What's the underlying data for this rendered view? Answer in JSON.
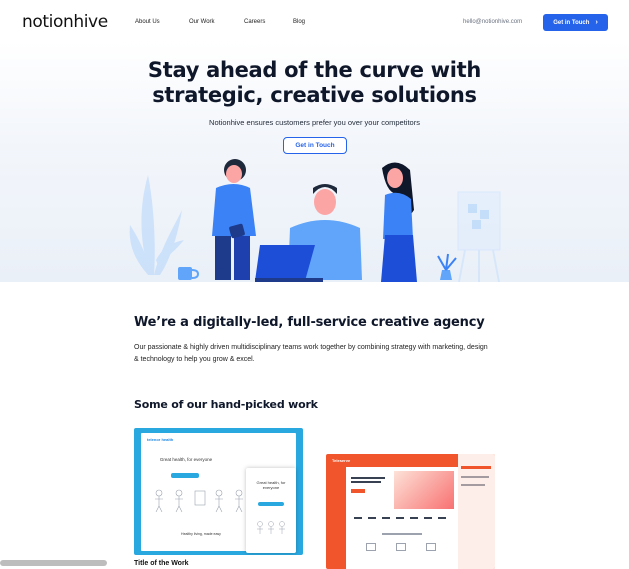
{
  "nav": {
    "logo": "notionhive",
    "links": [
      "About Us",
      "Our Work",
      "Careers",
      "Blog"
    ],
    "email": "hello@notionhive.com",
    "cta": "Get in Touch"
  },
  "hero": {
    "title_line1": "Stay ahead of the curve with",
    "title_line2": "strategic, creative solutions",
    "subtitle": "Notionhive ensures customers prefer you over your competitors",
    "cta": "Get in Touch"
  },
  "agency": {
    "title": "We’re a digitally-led, full-service creative agency",
    "body": "Our passionate & highly driven multidisciplinary teams work together by combining strategy with marketing, design & technology to help you grow & excel."
  },
  "work": {
    "title": "Some of our hand-picked work",
    "item_title": "Title of the Work",
    "card1": {
      "brand": "telenor health",
      "headline": "Great health, for everyone",
      "sub_headline": "Great health, for everyone",
      "tagline": "Healthy living, made easy"
    },
    "card2": {
      "brand": "Teleserve"
    }
  },
  "colors": {
    "accent": "#2563eb",
    "illustration_blue": "#3b82f6",
    "card1_bg": "#29a8e0",
    "card2_bg": "#f0552b"
  }
}
